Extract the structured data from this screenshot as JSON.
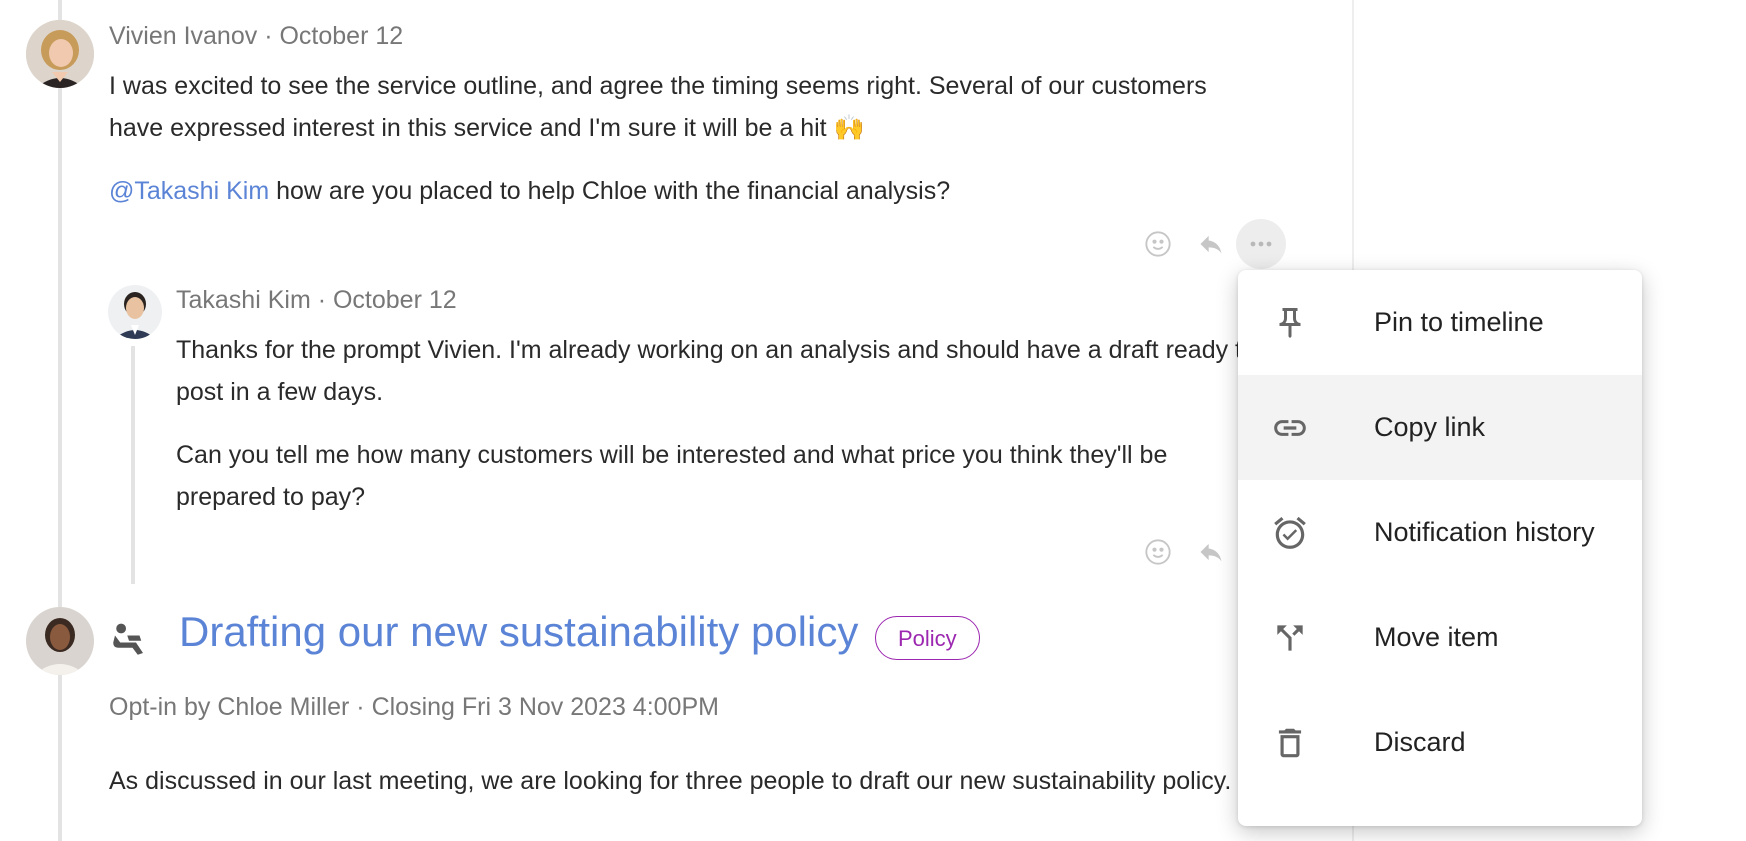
{
  "thread": {
    "comment1": {
      "author": "Vivien Ivanov",
      "date": "October 12",
      "para1": "I was excited to see the service outline, and agree the timing seems right. Several of our customers have expressed interest in this service and I'm sure it will be a hit 🙌",
      "mention": "@Takashi Kim",
      "para2_rest": " how are you placed to help Chloe with the financial analysis?"
    },
    "reply1": {
      "author": "Takashi Kim",
      "date": "October 12",
      "para1": "Thanks for the prompt Vivien. I'm already working on an analysis and should have a draft ready to post in a few days.",
      "para2": "Can you tell me how many customers will be interested and what price you think they'll be prepared to pay?"
    },
    "separator": " · "
  },
  "post": {
    "title": "Drafting our new sustainability policy",
    "badge": "Policy",
    "meta": "Opt-in by Chloe Miller · Closing Fri 3 Nov 2023 4:00PM",
    "body": "As discussed in our last meeting, we are looking for three people to draft our new sustainability policy."
  },
  "menu": {
    "items": [
      {
        "label": "Pin to timeline",
        "icon": "pin-icon"
      },
      {
        "label": "Copy link",
        "icon": "link-icon"
      },
      {
        "label": "Notification history",
        "icon": "alarm-icon"
      },
      {
        "label": "Move item",
        "icon": "call-split-icon"
      },
      {
        "label": "Discard",
        "icon": "trash-icon"
      }
    ],
    "highlighted_index": 1
  },
  "colors": {
    "accent": "#5b84d6",
    "badge": "#9c27b0",
    "icon": "#c6c6c6"
  }
}
